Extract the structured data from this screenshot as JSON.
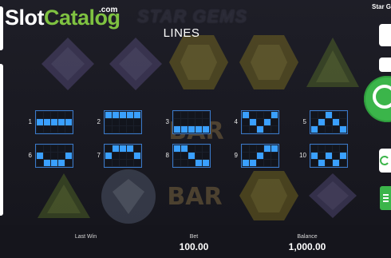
{
  "watermark": {
    "slot": "Slot",
    "catalog": "Catalog",
    "com": ".com"
  },
  "game": {
    "title": "STAR GEMS",
    "corner_title": "Star Gems"
  },
  "lines_panel": {
    "title": "LINES",
    "paylines": [
      {
        "number": "1",
        "pattern": [
          [
            0,
            0,
            0,
            0,
            0
          ],
          [
            1,
            1,
            1,
            1,
            1
          ],
          [
            0,
            0,
            0,
            0,
            0
          ]
        ]
      },
      {
        "number": "2",
        "pattern": [
          [
            1,
            1,
            1,
            1,
            1
          ],
          [
            0,
            0,
            0,
            0,
            0
          ],
          [
            0,
            0,
            0,
            0,
            0
          ]
        ]
      },
      {
        "number": "3",
        "pattern": [
          [
            0,
            0,
            0,
            0,
            0
          ],
          [
            0,
            0,
            0,
            0,
            0
          ],
          [
            1,
            1,
            1,
            1,
            1
          ]
        ]
      },
      {
        "number": "4",
        "pattern": [
          [
            1,
            0,
            0,
            0,
            1
          ],
          [
            0,
            1,
            0,
            1,
            0
          ],
          [
            0,
            0,
            1,
            0,
            0
          ]
        ]
      },
      {
        "number": "5",
        "pattern": [
          [
            0,
            0,
            1,
            0,
            0
          ],
          [
            0,
            1,
            0,
            1,
            0
          ],
          [
            1,
            0,
            0,
            0,
            1
          ]
        ]
      },
      {
        "number": "6",
        "pattern": [
          [
            0,
            0,
            0,
            0,
            0
          ],
          [
            1,
            0,
            0,
            0,
            1
          ],
          [
            0,
            1,
            1,
            1,
            0
          ]
        ]
      },
      {
        "number": "7",
        "pattern": [
          [
            0,
            1,
            1,
            1,
            0
          ],
          [
            1,
            0,
            0,
            0,
            1
          ],
          [
            0,
            0,
            0,
            0,
            0
          ]
        ]
      },
      {
        "number": "8",
        "pattern": [
          [
            1,
            1,
            0,
            0,
            0
          ],
          [
            0,
            0,
            1,
            0,
            0
          ],
          [
            0,
            0,
            0,
            1,
            1
          ]
        ]
      },
      {
        "number": "9",
        "pattern": [
          [
            0,
            0,
            0,
            1,
            1
          ],
          [
            0,
            0,
            1,
            0,
            0
          ],
          [
            1,
            1,
            0,
            0,
            0
          ]
        ]
      },
      {
        "number": "10",
        "pattern": [
          [
            0,
            0,
            0,
            0,
            0
          ],
          [
            1,
            0,
            1,
            0,
            1
          ],
          [
            0,
            1,
            0,
            1,
            0
          ]
        ]
      }
    ]
  },
  "status": {
    "last_win_label": "Last Win",
    "last_win_value": "",
    "bet_label": "Bet",
    "bet_value": "100.00",
    "balance_label": "Balance",
    "balance_value": "1,000.00"
  },
  "icons": {
    "spin": "spin-icon",
    "autoplay": "autoplay-icon",
    "menu": "menu-icon"
  },
  "colors": {
    "accent_green": "#3bb54a",
    "payline_blue": "#3aa0ff",
    "logo_green": "#7fc241"
  }
}
